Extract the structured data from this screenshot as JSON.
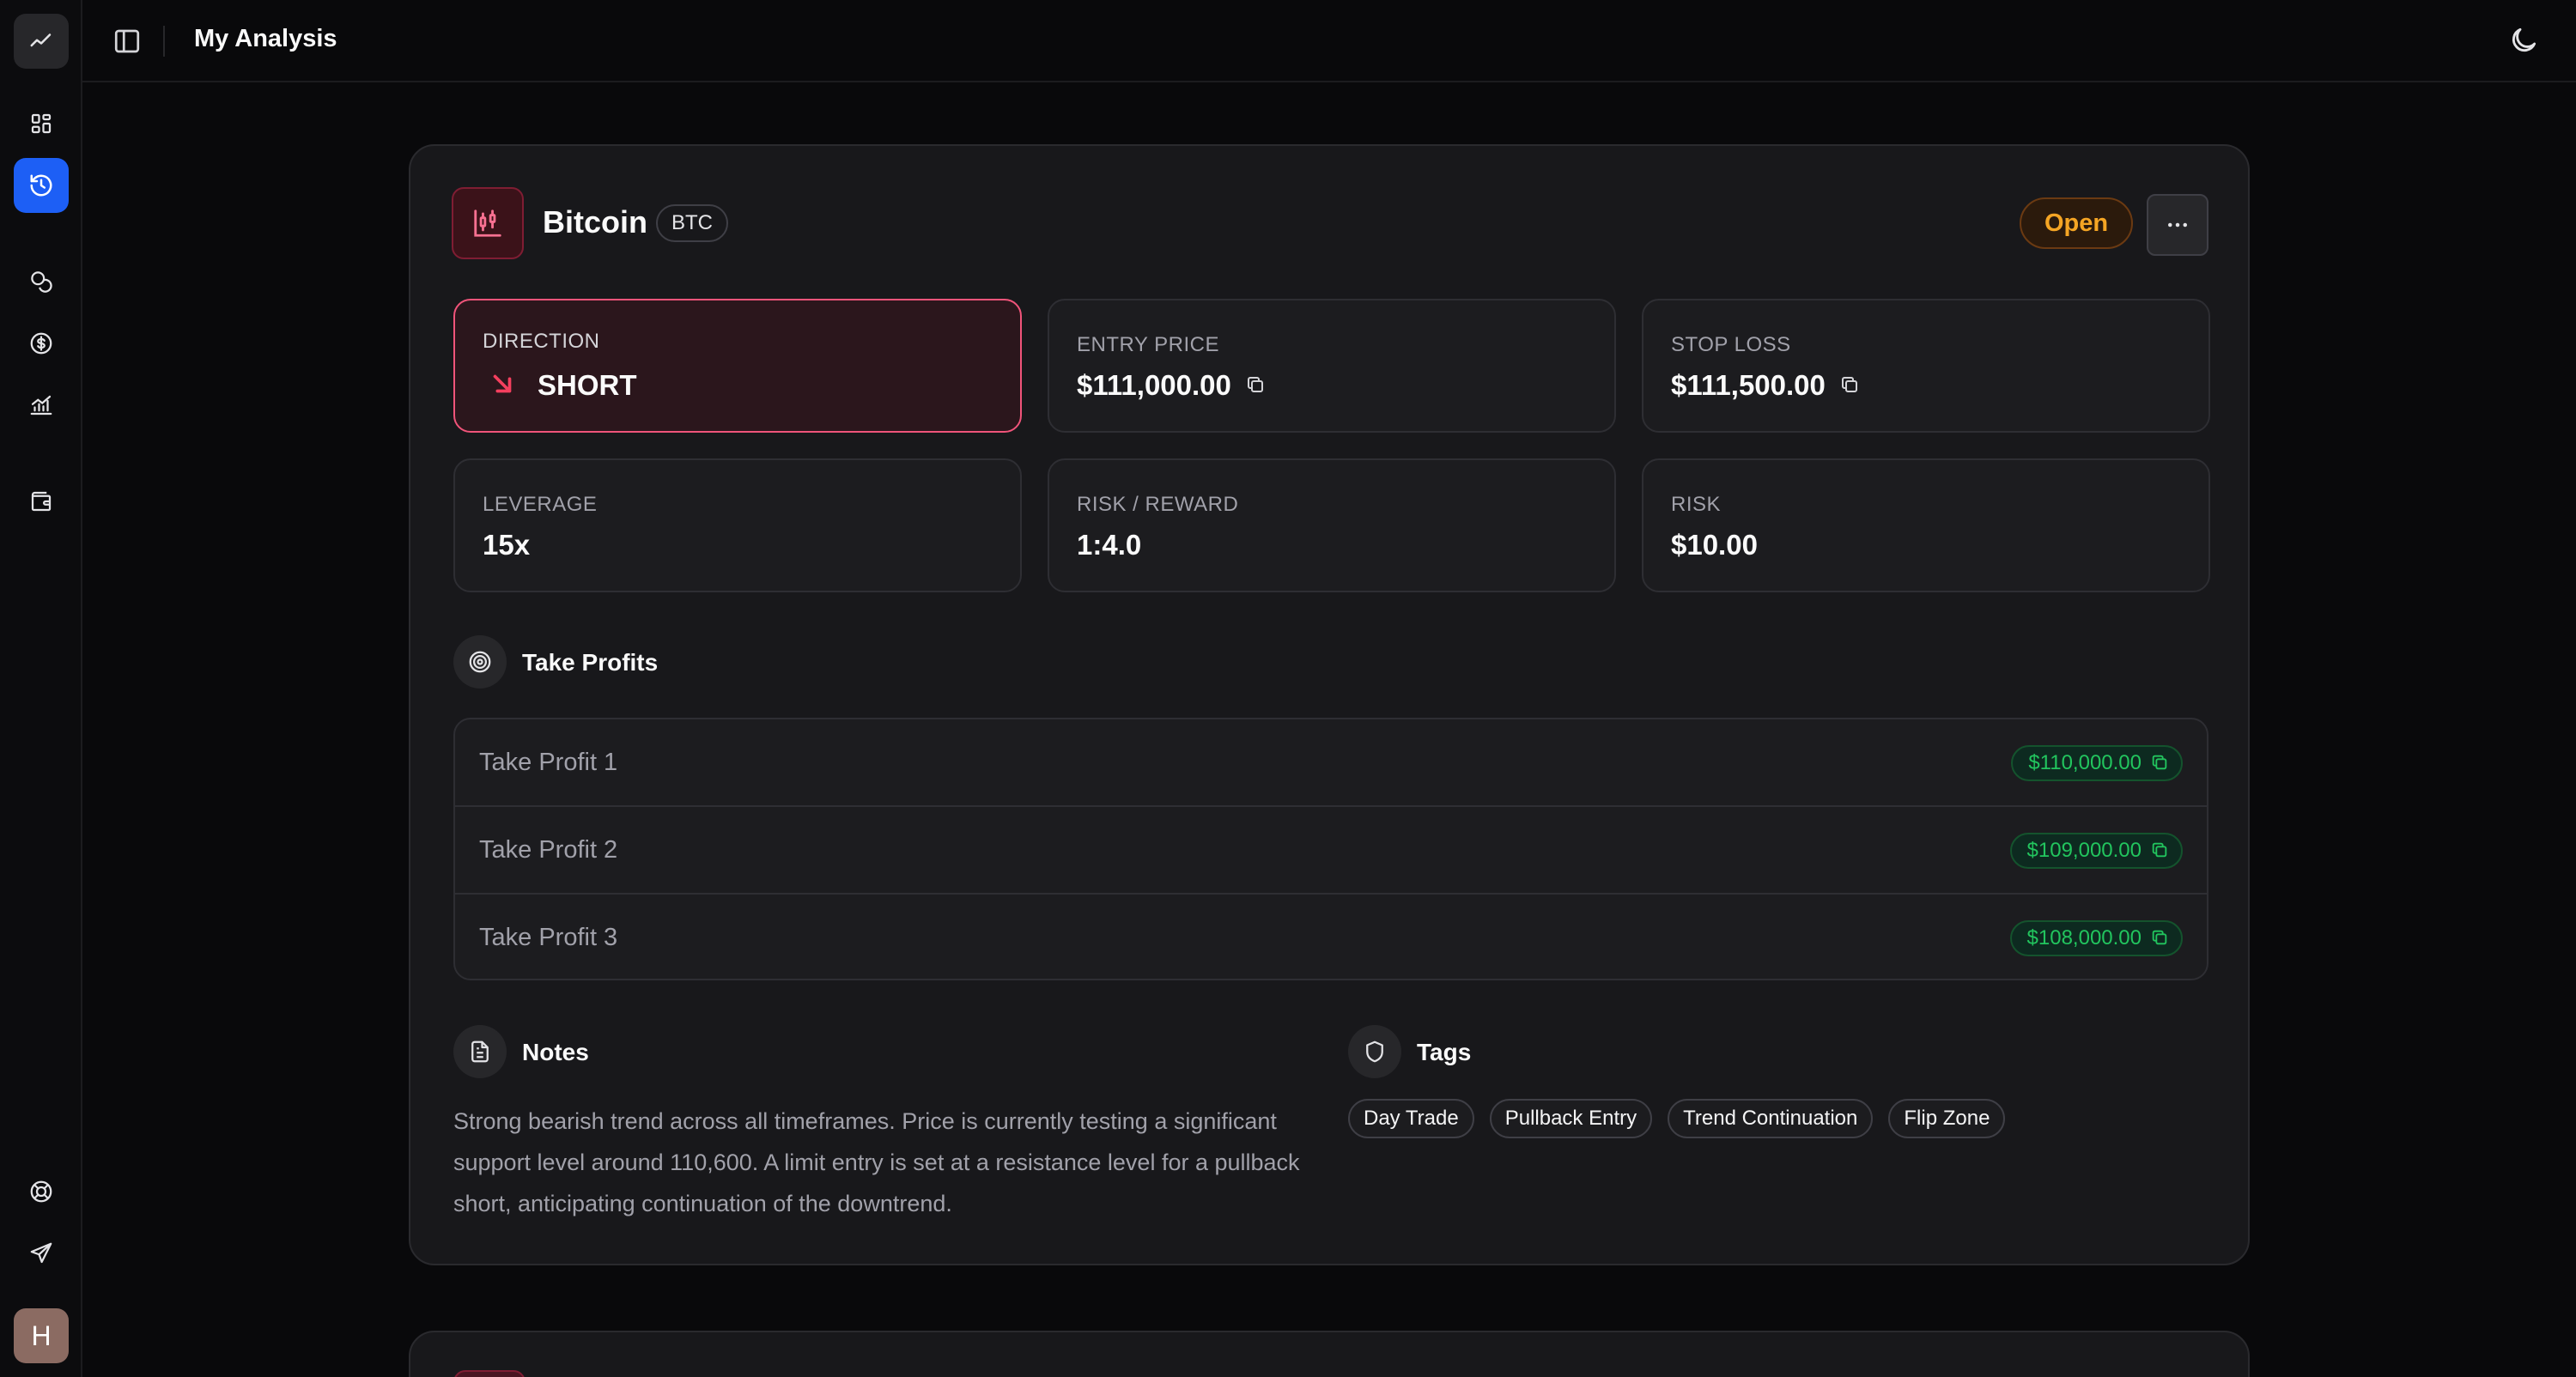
{
  "topbar": {
    "title": "My Analysis"
  },
  "sidebar": {
    "items": [
      {
        "icon": "trend-line-icon"
      },
      {
        "icon": "dashboard-icon"
      },
      {
        "icon": "history-icon",
        "active": true
      },
      {
        "icon": "coins-icon"
      },
      {
        "icon": "dollar-circle-icon"
      },
      {
        "icon": "chart-icon"
      },
      {
        "icon": "wallet-icon"
      },
      {
        "icon": "lifebuoy-icon"
      },
      {
        "icon": "send-icon"
      }
    ],
    "avatar_initial": "H"
  },
  "trade": {
    "asset_name": "Bitcoin",
    "ticker": "BTC",
    "status": "Open",
    "direction_label": "DIRECTION",
    "direction": "SHORT",
    "entry_label": "ENTRY PRICE",
    "entry_price": "$111,000.00",
    "stop_label": "STOP LOSS",
    "stop_loss": "$111,500.00",
    "leverage_label": "LEVERAGE",
    "leverage": "15x",
    "rr_label": "RISK / REWARD",
    "risk_reward": "1:4.0",
    "risk_label": "RISK",
    "risk": "$10.00"
  },
  "take_profits": {
    "title": "Take Profits",
    "items": [
      {
        "label": "Take Profit 1",
        "value": "$110,000.00"
      },
      {
        "label": "Take Profit 2",
        "value": "$109,000.00"
      },
      {
        "label": "Take Profit 3",
        "value": "$108,000.00"
      }
    ]
  },
  "notes": {
    "title": "Notes",
    "text": "Strong bearish trend across all timeframes. Price is currently testing a significant support level around 110,600. A limit entry is set at a resistance level for a pullback short, anticipating continuation of the downtrend."
  },
  "tags": {
    "title": "Tags",
    "items": [
      "Day Trade",
      "Pullback Entry",
      "Trend Continuation",
      "Flip Zone"
    ]
  },
  "colors": {
    "accent_blue": "#1d5ff5",
    "short_red": "#f43f5e",
    "profit_green": "#22c55e",
    "open_amber": "#f5a524"
  }
}
